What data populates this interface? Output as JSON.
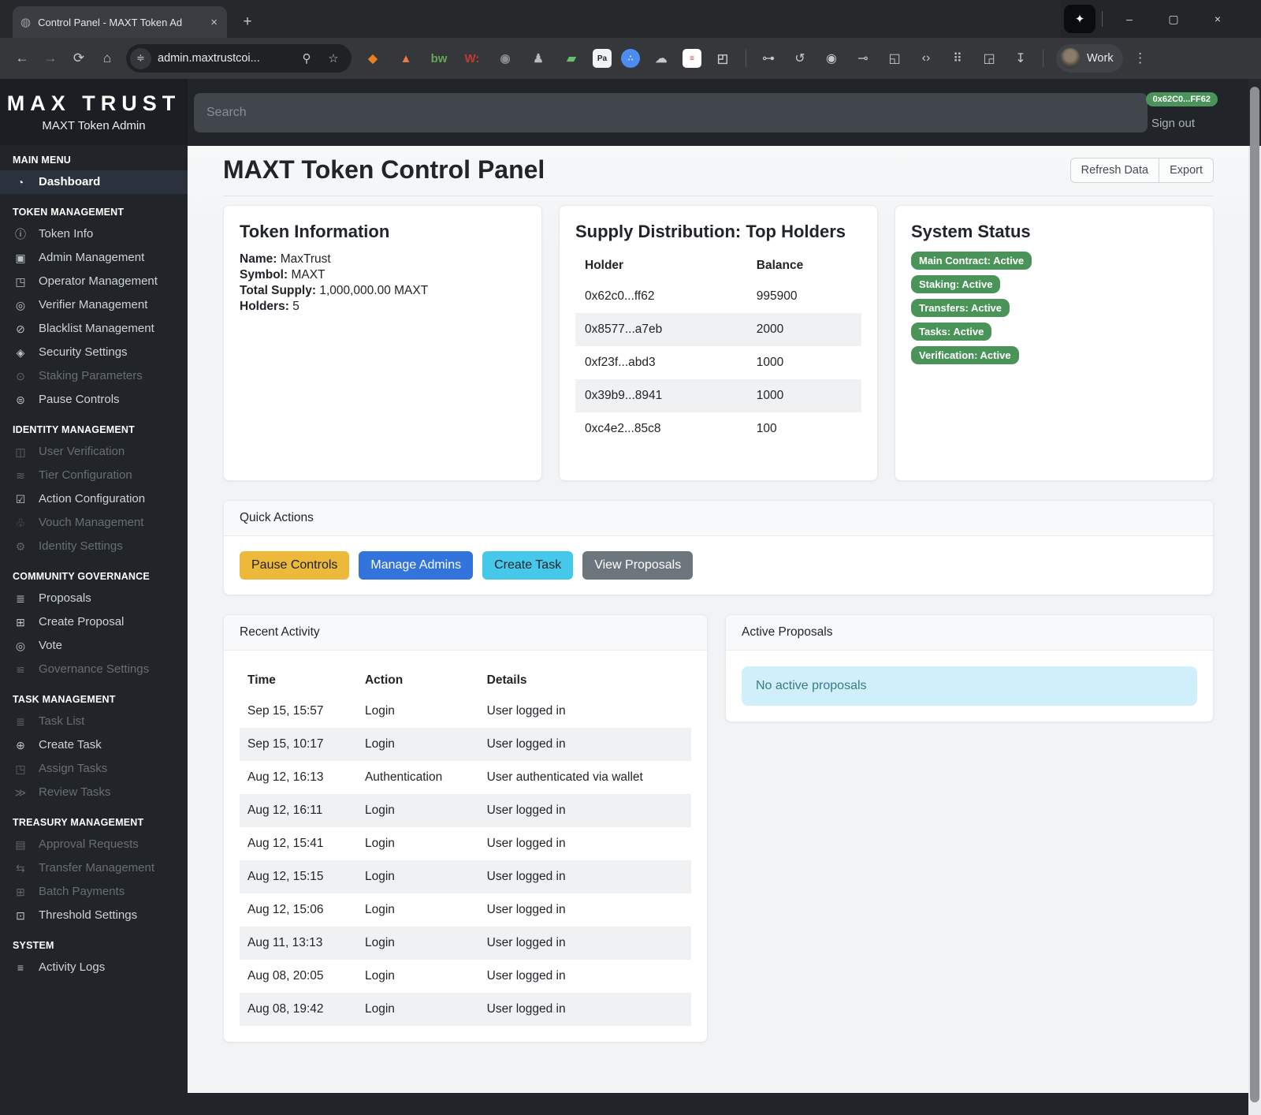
{
  "browser": {
    "tab_title": "Control Panel - MAXT Token Ad",
    "url": "admin.maxtrustcoi...",
    "profile_label": "Work",
    "extension_icons": [
      "metamask-icon",
      "lighthouse-icon",
      "bw-icon",
      "wot-icon",
      "target-icon",
      "figure-icon",
      "folder-icon",
      "password-icon",
      "share-icon",
      "cloud-icon",
      "notes-icon",
      "extensions-puzzle-icon"
    ],
    "pinned_icons": [
      "key-icon",
      "history-icon",
      "privacy-icon",
      "link-icon",
      "devices-icon",
      "code-icon",
      "qr-code-icon",
      "page-search-icon",
      "download-icon"
    ]
  },
  "topbar": {
    "search_placeholder": "Search",
    "wallet_badge": "0x62C0...FF62",
    "sign_out": "Sign out"
  },
  "sidebar": {
    "brand": "MAX TRUST",
    "subtitle": "MAXT Token Admin",
    "sections": [
      {
        "label": "MAIN MENU",
        "items": [
          {
            "label": "Dashboard",
            "icon": "gauge-icon",
            "state": "active"
          }
        ]
      },
      {
        "label": "TOKEN MANAGEMENT",
        "items": [
          {
            "label": "Token Info",
            "icon": "info-icon",
            "state": "normal"
          },
          {
            "label": "Admin Management",
            "icon": "id-badge-icon",
            "state": "normal"
          },
          {
            "label": "Operator Management",
            "icon": "person-gear-icon",
            "state": "normal"
          },
          {
            "label": "Verifier Management",
            "icon": "check-circle-icon",
            "state": "normal"
          },
          {
            "label": "Blacklist Management",
            "icon": "slash-circle-icon",
            "state": "normal"
          },
          {
            "label": "Security Settings",
            "icon": "shield-icon",
            "state": "normal"
          },
          {
            "label": "Staking Parameters",
            "icon": "coin-icon",
            "state": "disabled"
          },
          {
            "label": "Pause Controls",
            "icon": "pause-circle-icon",
            "state": "normal"
          }
        ]
      },
      {
        "label": "IDENTITY MANAGEMENT",
        "items": [
          {
            "label": "User Verification",
            "icon": "people-check-icon",
            "state": "disabled"
          },
          {
            "label": "Tier Configuration",
            "icon": "layers-icon",
            "state": "disabled"
          },
          {
            "label": "Action Configuration",
            "icon": "check-square-icon",
            "state": "normal"
          },
          {
            "label": "Vouch Management",
            "icon": "thumb-icon",
            "state": "disabled"
          },
          {
            "label": "Identity Settings",
            "icon": "gear-icon",
            "state": "disabled"
          }
        ]
      },
      {
        "label": "COMMUNITY GOVERNANCE",
        "items": [
          {
            "label": "Proposals",
            "icon": "list-icon",
            "state": "normal"
          },
          {
            "label": "Create Proposal",
            "icon": "plus-square-icon",
            "state": "normal"
          },
          {
            "label": "Vote",
            "icon": "check-circle-icon",
            "state": "normal"
          },
          {
            "label": "Governance Settings",
            "icon": "sliders-icon",
            "state": "disabled"
          }
        ]
      },
      {
        "label": "TASK MANAGEMENT",
        "items": [
          {
            "label": "Task List",
            "icon": "list-icon",
            "state": "disabled"
          },
          {
            "label": "Create Task",
            "icon": "plus-circle-icon",
            "state": "normal"
          },
          {
            "label": "Assign Tasks",
            "icon": "person-gear-icon",
            "state": "disabled"
          },
          {
            "label": "Review Tasks",
            "icon": "double-check-icon",
            "state": "disabled"
          }
        ]
      },
      {
        "label": "TREASURY MANAGEMENT",
        "items": [
          {
            "label": "Approval Requests",
            "icon": "clipboard-check-icon",
            "state": "disabled"
          },
          {
            "label": "Transfer Management",
            "icon": "transfer-icon",
            "state": "disabled"
          },
          {
            "label": "Batch Payments",
            "icon": "grid-icon",
            "state": "disabled"
          },
          {
            "label": "Threshold Settings",
            "icon": "threshold-icon",
            "state": "normal"
          }
        ]
      },
      {
        "label": "SYSTEM",
        "items": [
          {
            "label": "Activity Logs",
            "icon": "journal-icon",
            "state": "normal"
          }
        ]
      }
    ]
  },
  "main": {
    "title": "MAXT Token Control Panel",
    "refresh_button": "Refresh Data",
    "export_button": "Export",
    "token_info": {
      "title": "Token Information",
      "fields": [
        {
          "label": "Name:",
          "value": "MaxTrust"
        },
        {
          "label": "Symbol:",
          "value": "MAXT"
        },
        {
          "label": "Total Supply:",
          "value": "1,000,000.00 MAXT"
        },
        {
          "label": "Holders:",
          "value": "5"
        }
      ]
    },
    "top_holders": {
      "title": "Supply Distribution: Top Holders",
      "columns": [
        "Holder",
        "Balance"
      ],
      "rows": [
        [
          "0x62c0...ff62",
          "995900"
        ],
        [
          "0x8577...a7eb",
          "2000"
        ],
        [
          "0xf23f...abd3",
          "1000"
        ],
        [
          "0x39b9...8941",
          "1000"
        ],
        [
          "0xc4e2...85c8",
          "100"
        ]
      ]
    },
    "system_status": {
      "title": "System Status",
      "badges": [
        "Main Contract: Active",
        "Staking: Active",
        "Transfers: Active",
        "Tasks: Active",
        "Verification: Active"
      ]
    },
    "quick_actions": {
      "title": "Quick Actions",
      "buttons": [
        {
          "label": "Pause Controls",
          "variant": "warning"
        },
        {
          "label": "Manage Admins",
          "variant": "primary"
        },
        {
          "label": "Create Task",
          "variant": "info"
        },
        {
          "label": "View Proposals",
          "variant": "secondary"
        }
      ]
    },
    "recent_activity": {
      "title": "Recent Activity",
      "columns": [
        "Time",
        "Action",
        "Details"
      ],
      "rows": [
        [
          "Sep 15, 15:57",
          "Login",
          "User logged in"
        ],
        [
          "Sep 15, 10:17",
          "Login",
          "User logged in"
        ],
        [
          "Aug 12, 16:13",
          "Authentication",
          "User authenticated via wallet"
        ],
        [
          "Aug 12, 16:11",
          "Login",
          "User logged in"
        ],
        [
          "Aug 12, 15:41",
          "Login",
          "User logged in"
        ],
        [
          "Aug 12, 15:15",
          "Login",
          "User logged in"
        ],
        [
          "Aug 12, 15:06",
          "Login",
          "User logged in"
        ],
        [
          "Aug 11, 13:13",
          "Login",
          "User logged in"
        ],
        [
          "Aug 08, 20:05",
          "Login",
          "User logged in"
        ],
        [
          "Aug 08, 19:42",
          "Login",
          "User logged in"
        ]
      ]
    },
    "active_proposals": {
      "title": "Active Proposals",
      "empty_message": "No active proposals"
    }
  },
  "colors": {
    "sidebar_bg": "#212529",
    "topbar_bg": "#212529",
    "page_bg": "#f1f3f5",
    "success_badge": "#4a9459",
    "warning_button": "#ecb93b",
    "primary_button": "#3273dc",
    "info_button": "#45c8ea",
    "secondary_button": "#6d757d",
    "info_alert_bg": "#cff0fa"
  }
}
